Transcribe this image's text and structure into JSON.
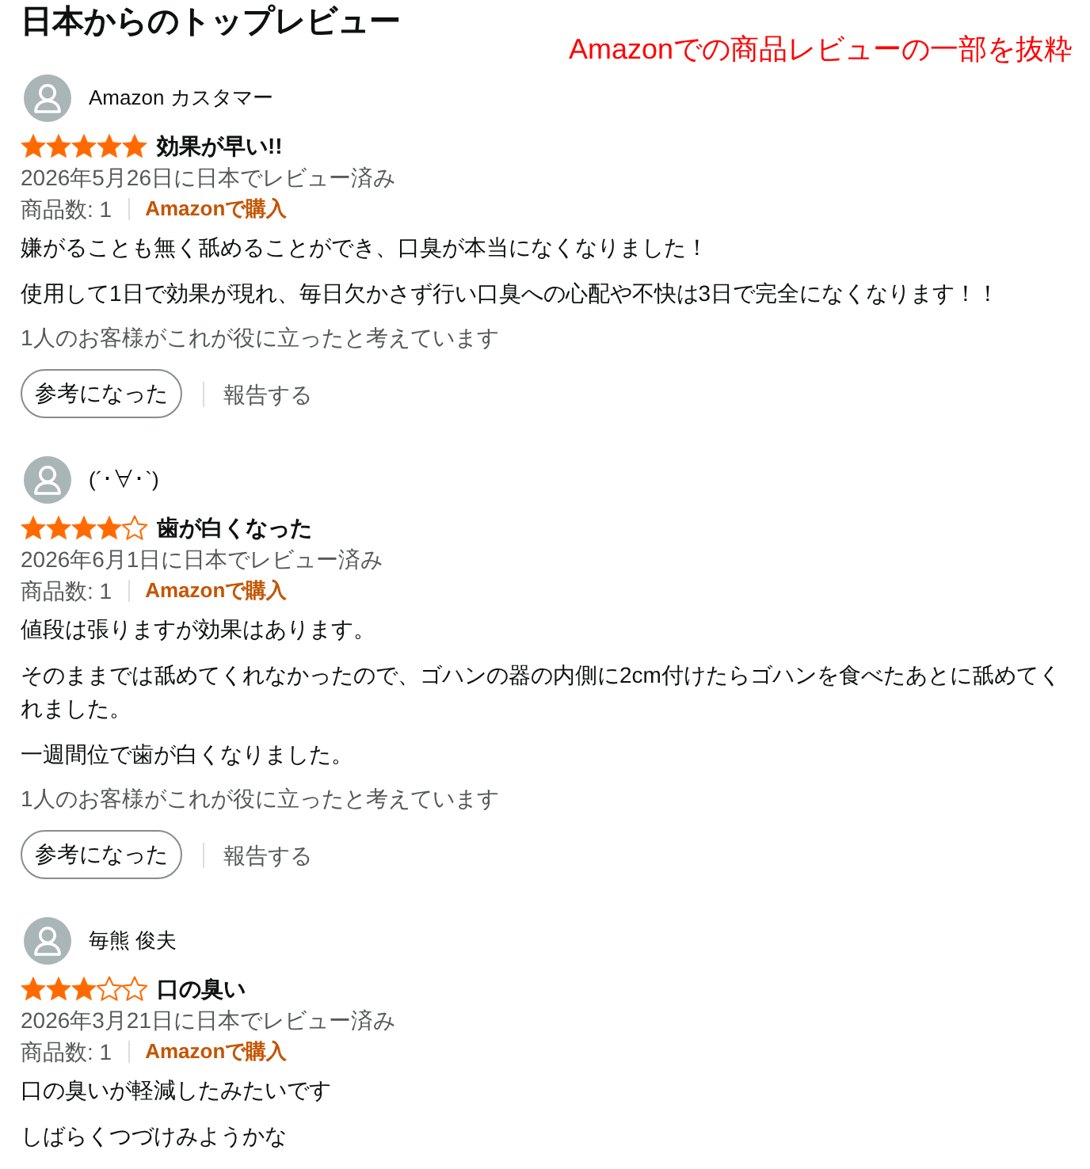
{
  "heading": "日本からのトップレビュー",
  "annotation": "Amazonでの商品レビューの一部を抜粋",
  "reviews": [
    {
      "author": "Amazon カスタマー",
      "stars": 5,
      "title": "効果が早い!!",
      "date": "2026年5月26日に日本でレビュー済み",
      "quantity": "商品数: 1",
      "purchase_label": "Amazonで購入",
      "body": [
        "嫌がることも無く舐めることができ、口臭が本当になくなりました！",
        "使用して1日で効果が現れ、毎日欠かさず行い口臭への心配や不快は3日で完全になくなります！！"
      ],
      "helpful_count": "1人のお客様がこれが役に立ったと考えています",
      "helpful_button": "参考になった",
      "report_link": "報告する"
    },
    {
      "author": "(´･∀･`)",
      "stars": 4,
      "title": "歯が白くなった",
      "date": "2026年6月1日に日本でレビュー済み",
      "quantity": "商品数: 1",
      "purchase_label": "Amazonで購入",
      "body": [
        "値段は張りますが効果はあります。",
        "そのままでは舐めてくれなかったので、ゴハンの器の内側に2cm付けたらゴハンを食べたあとに舐めてくれました。",
        "一週間位で歯が白くなりました。"
      ],
      "helpful_count": "1人のお客様がこれが役に立ったと考えています",
      "helpful_button": "参考になった",
      "report_link": "報告する"
    },
    {
      "author": "毎熊 俊夫",
      "stars": 3,
      "title": "口の臭い",
      "date": "2026年3月21日に日本でレビュー済み",
      "quantity": "商品数: 1",
      "purchase_label": "Amazonで購入",
      "body": [
        "口の臭いが軽減したみたいです",
        "しばらくつづけみようかな"
      ]
    }
  ]
}
